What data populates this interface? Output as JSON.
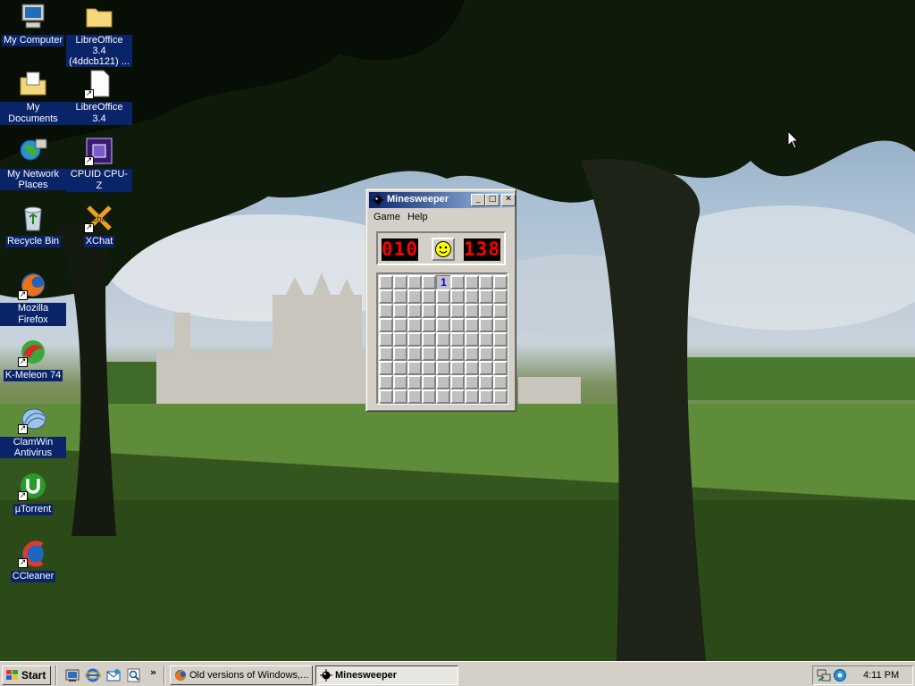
{
  "desktop": {
    "icons": [
      {
        "label": "My Computer",
        "icon": "my-computer-icon"
      },
      {
        "label": "LibreOffice 3.4 (4ddcb121) ...",
        "icon": "folder-icon"
      },
      {
        "label": "My Documents",
        "icon": "my-documents-icon"
      },
      {
        "label": "LibreOffice 3.4",
        "icon": "document-shortcut-icon"
      },
      {
        "label": "My Network Places",
        "icon": "network-places-icon"
      },
      {
        "label": "CPUID CPU-Z",
        "icon": "cpu-z-icon"
      },
      {
        "label": "Recycle Bin",
        "icon": "recycle-bin-icon"
      },
      {
        "label": "XChat",
        "icon": "xchat-icon"
      },
      {
        "label": "Mozilla Firefox",
        "icon": "firefox-icon"
      },
      {
        "label": "K-Meleon 74",
        "icon": "k-meleon-icon"
      },
      {
        "label": "ClamWin Antivirus",
        "icon": "clamwin-icon"
      },
      {
        "label": "µTorrent",
        "icon": "utorrent-icon"
      },
      {
        "label": "CCleaner",
        "icon": "ccleaner-icon"
      }
    ]
  },
  "minesweeper": {
    "title": "Minesweeper",
    "menu": [
      "Game",
      "Help"
    ],
    "mine_counter": "010",
    "timer": "138",
    "face": "smiley-face-icon",
    "grid": {
      "rows": 9,
      "cols": 9,
      "revealed": [
        {
          "row": 0,
          "col": 4,
          "value": "1"
        }
      ]
    },
    "controls": {
      "minimize": "_",
      "maximize": "□",
      "close": "✕"
    }
  },
  "taskbar": {
    "start_label": "Start",
    "quick_launch": [
      "show-desktop-icon",
      "internet-explorer-icon",
      "outlook-express-icon",
      "search-icon"
    ],
    "chevron": "»",
    "buttons": [
      {
        "label": "Old versions of Windows,...",
        "icon": "firefox-icon",
        "active": false
      },
      {
        "label": "Minesweeper",
        "icon": "minesweeper-icon",
        "active": true
      }
    ],
    "tray_icons": [
      "network-icon",
      "volume-icon"
    ],
    "clock": "4:11 PM"
  },
  "colors": {
    "selection": "#0a246a",
    "titlebar_start": "#0a246a",
    "titlebar_end": "#a6caf0",
    "lcd": "#ff0000",
    "face_bg": "#d4d0c8",
    "number_one": "#0000ff"
  }
}
